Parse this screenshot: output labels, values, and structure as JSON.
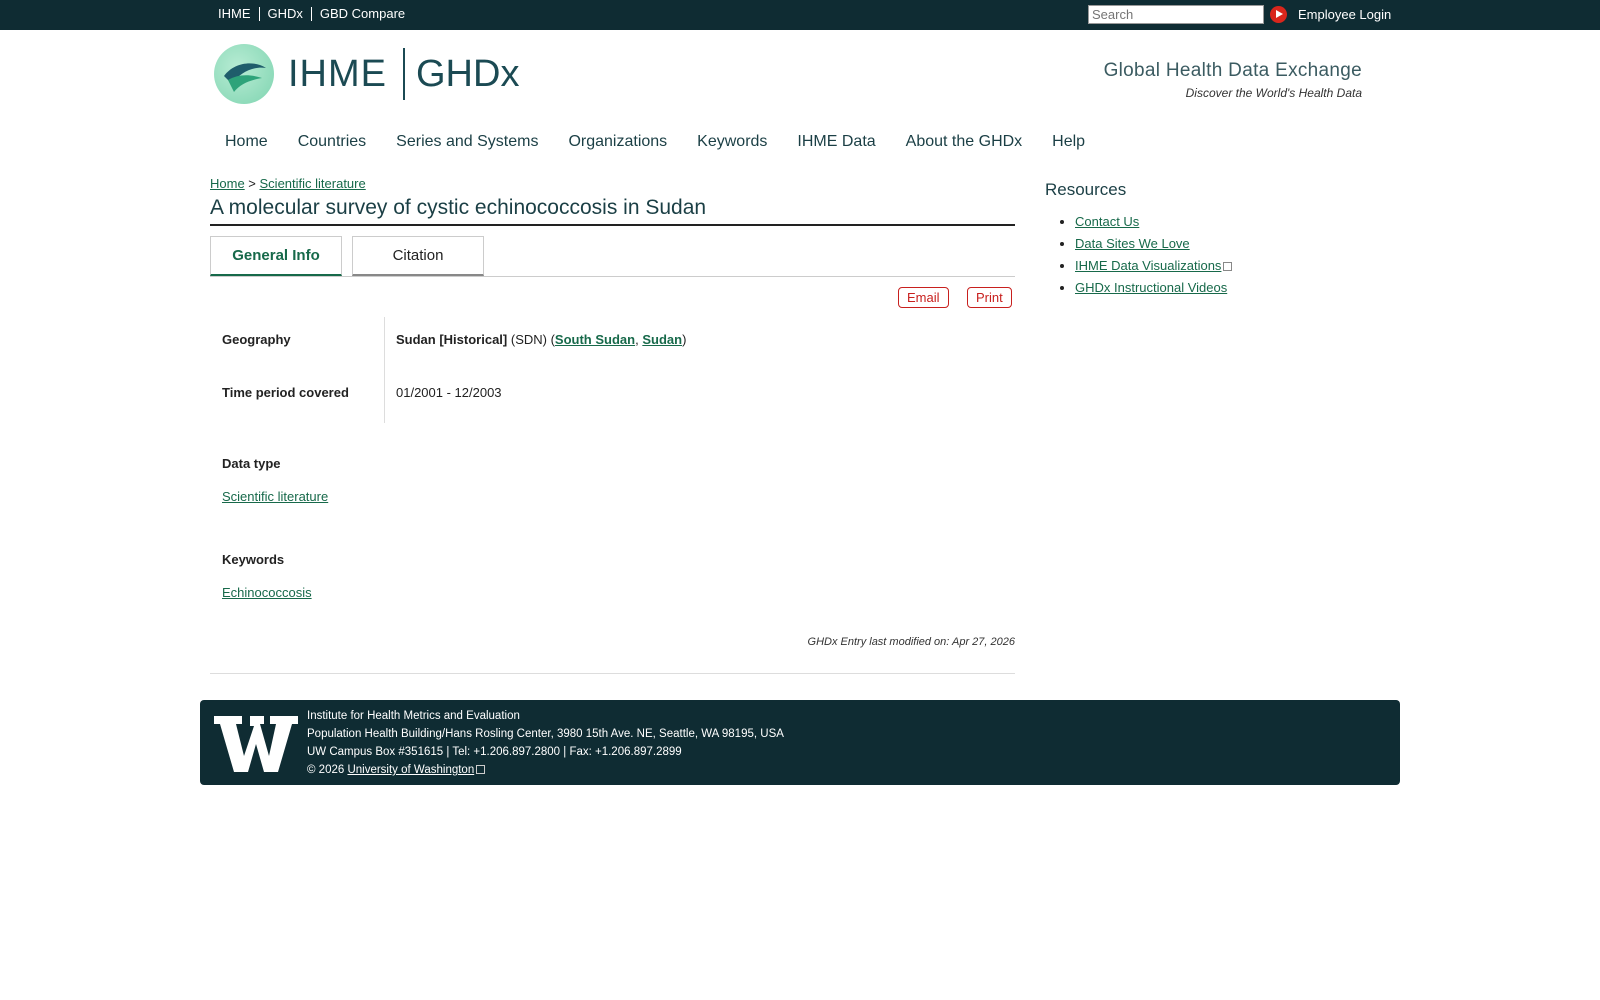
{
  "topbar": {
    "links": [
      "IHME",
      "GHDx",
      "GBD Compare"
    ],
    "search_placeholder": "Search",
    "login": "Employee Login"
  },
  "header": {
    "logo_ihme": "IHME",
    "logo_ghdx": "GHDx",
    "tagline": "Global Health Data Exchange",
    "subtagline": "Discover the World's Health Data"
  },
  "nav": [
    "Home",
    "Countries",
    "Series and Systems",
    "Organizations",
    "Keywords",
    "IHME Data",
    "About the GHDx",
    "Help"
  ],
  "breadcrumb": {
    "home": "Home",
    "sep": " > ",
    "section": "Scientific literature"
  },
  "page_title": "A molecular survey of cystic echinococcosis in Sudan",
  "tabs": {
    "general": "General Info",
    "citation": "Citation"
  },
  "actions": {
    "email": "Email",
    "print": "Print"
  },
  "info": {
    "geography_label": "Geography",
    "geography_country": "Sudan [Historical]",
    "geography_code": " (SDN) (",
    "geography_link1": "South Sudan",
    "geography_comma": ", ",
    "geography_link2": "Sudan",
    "geography_close": ")",
    "time_label": "Time period covered",
    "time_value": "01/2001 - 12/2003",
    "datatype_label": "Data type",
    "datatype_value": "Scientific literature",
    "keywords_label": "Keywords",
    "keywords_value": "Echinococcosis",
    "modified": "GHDx Entry last modified on: Apr 27, 2026"
  },
  "resources": {
    "title": "Resources",
    "items": [
      "Contact Us",
      "Data Sites We Love",
      "IHME Data Visualizations",
      "GHDx Instructional Videos"
    ]
  },
  "footer": {
    "line1": "Institute for Health Metrics and Evaluation",
    "line2": "Population Health Building/Hans Rosling Center, 3980 15th Ave. NE, Seattle, WA 98195, USA",
    "line3": "UW Campus Box #351615 | Tel: +1.206.897.2800 | Fax: +1.206.897.2899",
    "line4_prefix": "© 2026 ",
    "line4_link": "University of Washington"
  }
}
